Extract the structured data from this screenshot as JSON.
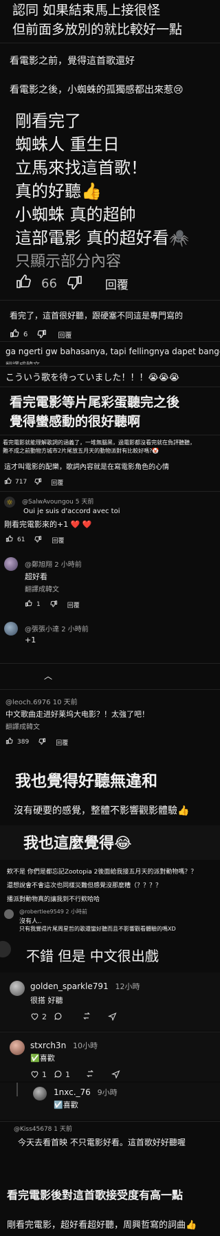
{
  "comments": {
    "c1": {
      "line1": "認同 如果結束馬上接很怪",
      "line2": "但前面多放別的就比較好一點"
    },
    "c2": {
      "line1": "看電影之前，覺得這首歌還好",
      "line2": "看電影之後，小蜘蛛的孤獨感都出來惹😢",
      "big1": "剛看完了",
      "big2": "蜘蛛人 重生日",
      "big3": "立馬來找這首歌！",
      "big4": "真的好聽👍",
      "big5": "小蜘蛛 真的超帥",
      "big6": "這部電影 真的超好看🕷️",
      "partial": "只顯示部分內容",
      "likes": "66",
      "reply": "回覆"
    },
    "c3": {
      "text": "看完了，這首很好聽，跟硬塞不同這是專門寫的",
      "likes": "6",
      "reply": "回覆"
    },
    "c4": {
      "text": "ga ngerti gw bahasanya, tapi fellingnya dapet banget",
      "translate": "翻譯成韓文"
    },
    "c5": {
      "text": "こういう歌を待っていました！！！😭😭😭"
    },
    "c6": {
      "line1": "看完電影等片尾彩蛋聽完之後",
      "line2": "覺得蠻感動的很好聽啊"
    },
    "c7": {
      "line1": "看完電影就能理解歌詞的涵義了，一堆無腦黑，過電影都沒看完就在負評聽聽，",
      "line2": "難不成之前動物方城市2片尾放五月天的動物派對有比較好嗎?🤡",
      "line3": "這才叫電影的配樂，歌詞內容就是在寫電影角色的心情",
      "likes": "717",
      "reply": "回覆"
    },
    "c8": {
      "user": "@SalwAvoungou",
      "time": "5 天前",
      "line1": "Oui je suis d'accord avec toi",
      "line2": "剛看完電影來的+1 ❤️ ❤️",
      "likes": "61",
      "reply": "回覆"
    },
    "c9": {
      "user": "@鄭旭翔",
      "time": "2 小時前",
      "text": "超好看",
      "translate": "翻譯成韓文",
      "likes": "1",
      "reply": "回覆"
    },
    "c10": {
      "user": "@張張小達",
      "time": "2 小時前",
      "text": "+1",
      "likes": "1",
      "reply": "回覆"
    },
    "hide": {
      "label": "隱藏回覆"
    },
    "c11": {
      "user": "@leoch.6976",
      "time": "10 天前",
      "text": "中文歌曲走进好莱坞大电影？！太強了吧！",
      "translate": "翻譯成韓文",
      "likes": "389",
      "reply": "回覆"
    },
    "c12": {
      "text": "我也覺得好聽無違和"
    },
    "c13": {
      "text": "沒有硬要的感覺，整體不影響觀影體驗👍"
    },
    "c14": {
      "text": "我也這麼覺得😂"
    },
    "c15": {
      "line1": "欸不是 你們是都忘記Zootopia 2後面給我接五月天的派對動物嗎？？",
      "line2": "還想說會不會這次也同樣災難但感覺沒那麼糟（？？？？",
      "line3": "播派對動物真的讓我到不行欸哈哈"
    },
    "c16": {
      "user": "@robertlee9549",
      "time": "2 小時前",
      "line1": "沒有人..",
      "line2": "只有我覺得片尾周星哲的歌還蠻好聽而且不影響觀看體驗的嗎XD"
    },
    "c17": {
      "text": "不錯 但是 中文很出戲"
    },
    "c18": {
      "user": "golden_sparkle791",
      "time": "12小時",
      "text": "很搭 好聽",
      "likes": "2"
    },
    "c19": {
      "user": "stxrch3n",
      "time": "10小時",
      "text": "✅喜歡",
      "likes": "1",
      "replies": "1"
    },
    "c20": {
      "user": "1nxc._76",
      "time": "9小時",
      "text": "☑️喜歡"
    },
    "c21": {
      "user": "@Kiss45678",
      "time": "1 天前",
      "text": "今天去看首映 不只電影好看。這首歌好好聽喔"
    },
    "c22": {
      "text": "看完電影後對這首歌接受度有高一點"
    },
    "c23": {
      "text": "剛看完電影，超好看超好聽，周興哲寫的詞曲👍"
    }
  }
}
